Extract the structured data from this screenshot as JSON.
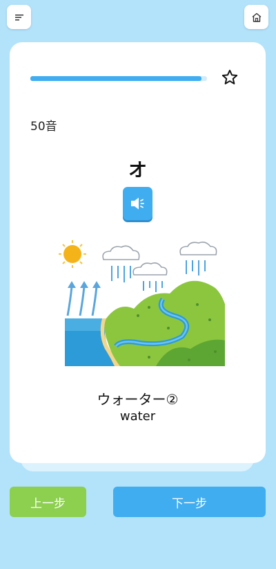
{
  "header": {
    "menu_icon": "hamburger-menu-icon",
    "home_icon": "home-icon"
  },
  "card": {
    "progress": 0.97,
    "favorite_icon": "star-outline-icon",
    "category": "50音",
    "kana": "オ",
    "sound_icon": "speaker-icon",
    "illustration": "water-cycle-illustration",
    "word": "ウォーター②",
    "meaning": "water"
  },
  "nav": {
    "prev_label": "上一步",
    "next_label": "下一步"
  },
  "colors": {
    "background": "#b3e3fb",
    "accent_blue": "#3fadf0",
    "accent_green": "#8dcf4f"
  }
}
